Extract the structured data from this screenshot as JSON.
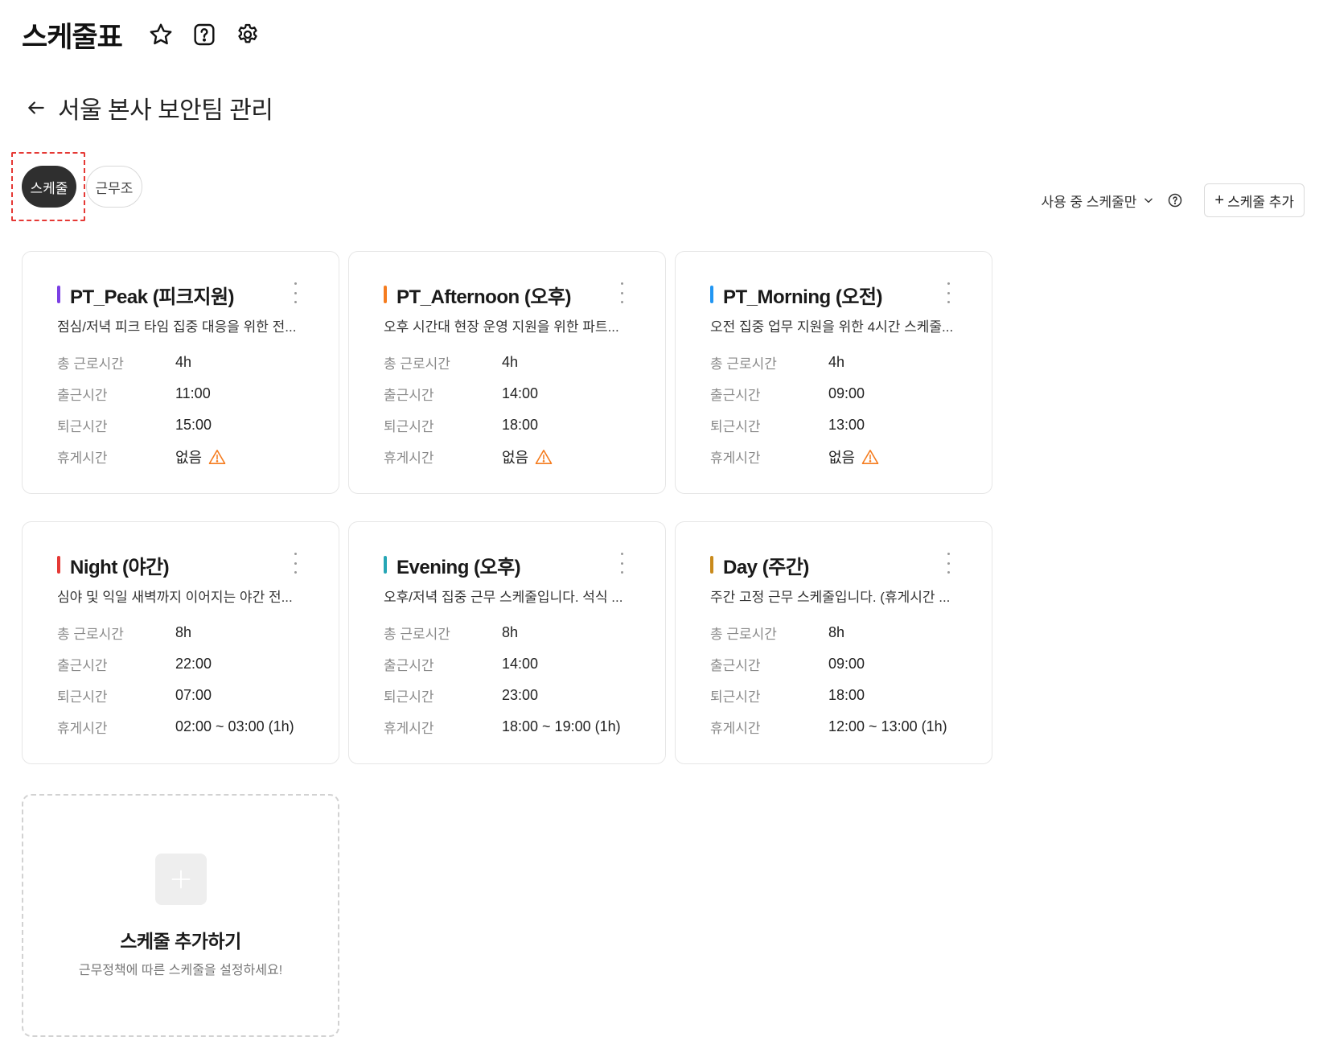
{
  "header": {
    "title": "스케줄표",
    "icons": [
      "star-icon",
      "help-icon",
      "gear-icon"
    ]
  },
  "sub": {
    "title": "서울 본사 보안팀 관리"
  },
  "tabs": [
    {
      "label": "스케줄",
      "active": true
    },
    {
      "label": "근무조",
      "active": false
    }
  ],
  "toolbar": {
    "filter_label": "사용 중 스케줄만",
    "add_label": "스케줄 추가"
  },
  "labels": {
    "total": "총 근로시간",
    "start": "출근시간",
    "end": "퇴근시간",
    "break": "휴게시간"
  },
  "cards": [
    {
      "name": "PT_Peak (피크지원)",
      "color": "#7b3fe4",
      "desc": "점심/저녁 피크 타임 집중 대응을 위한 전...",
      "total": "4h",
      "start": "11:00",
      "end": "15:00",
      "break": "없음",
      "warn": true
    },
    {
      "name": "PT_Afternoon (오후)",
      "color": "#f57c1f",
      "desc": "오후 시간대 현장 운영 지원을 위한 파트...",
      "total": "4h",
      "start": "14:00",
      "end": "18:00",
      "break": "없음",
      "warn": true
    },
    {
      "name": "PT_Morning (오전)",
      "color": "#2196f3",
      "desc": "오전 집중 업무 지원을 위한 4시간 스케줄...",
      "total": "4h",
      "start": "09:00",
      "end": "13:00",
      "break": "없음",
      "warn": true
    },
    {
      "name": "Night (야간)",
      "color": "#e53935",
      "desc": "심야 및 익일 새벽까지 이어지는 야간 전...",
      "total": "8h",
      "start": "22:00",
      "end": "07:00",
      "break": "02:00 ~ 03:00 (1h)",
      "warn": false
    },
    {
      "name": "Evening (오후)",
      "color": "#26a6b5",
      "desc": "오후/저녁 집중 근무 스케줄입니다. 석식 ...",
      "total": "8h",
      "start": "14:00",
      "end": "23:00",
      "break": "18:00 ~ 19:00 (1h)",
      "warn": false
    },
    {
      "name": "Day (주간)",
      "color": "#c98a1b",
      "desc": "주간 고정 근무 스케줄입니다. (휴게시간 ...",
      "total": "8h",
      "start": "09:00",
      "end": "18:00",
      "break": "12:00 ~ 13:00 (1h)",
      "warn": false
    }
  ],
  "add_card": {
    "title": "스케줄 추가하기",
    "desc": "근무정책에 따른 스케줄을 설정하세요!"
  },
  "colors": {
    "warning": "#f57c1f",
    "active_tab": "#2f2f2f",
    "highlight_border": "#e53935"
  }
}
